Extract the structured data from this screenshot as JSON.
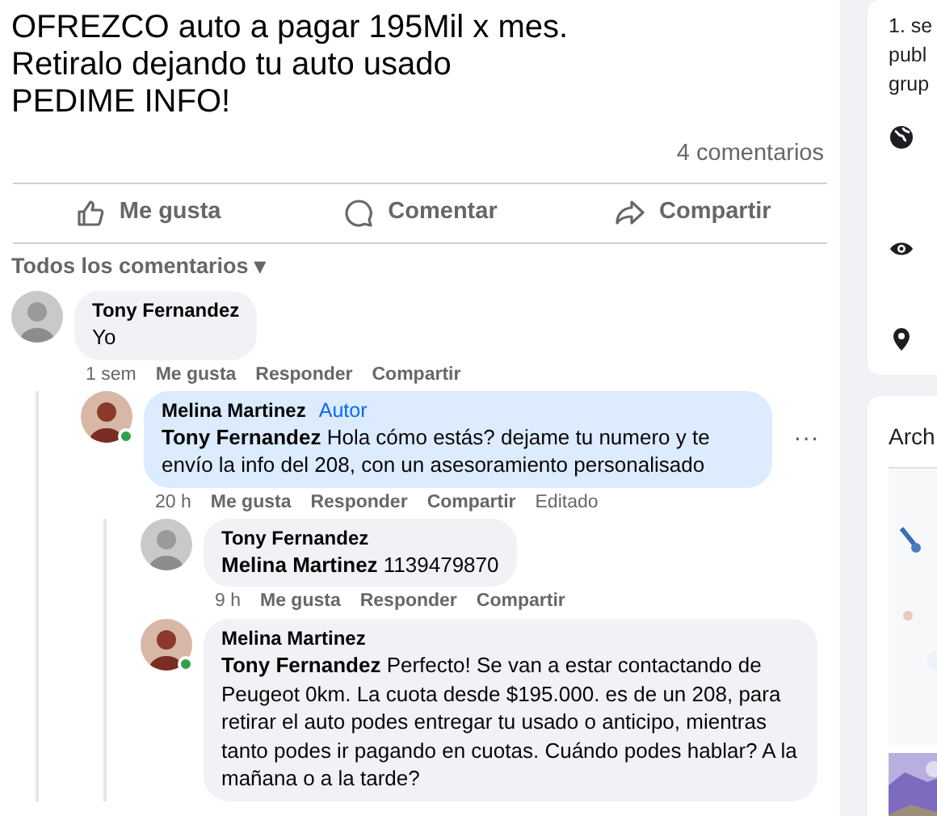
{
  "post": {
    "text_lines": [
      "OFREZCO auto a pagar 195Mil x mes.",
      "Retiralo dejando tu auto usado",
      "PEDIME INFO!"
    ],
    "comment_count": "4 comentarios"
  },
  "actions": [
    {
      "kind": "like",
      "label": "Me gusta"
    },
    {
      "kind": "comment",
      "label": "Comentar"
    },
    {
      "kind": "share",
      "label": "Compartir"
    }
  ],
  "sort": {
    "label": "Todos los comentarios",
    "caret": "▾"
  },
  "comments": [
    {
      "author": "Tony Fernandez",
      "online": false,
      "highlighted": false,
      "text": "Yo",
      "time": "1 sem",
      "actions": [
        "Me gusta",
        "Responder",
        "Compartir"
      ],
      "children": [
        {
          "author": "Melina Martinez",
          "badge": "Autor",
          "online": true,
          "highlighted": true,
          "more_menu": "···",
          "mention": "Tony Fernandez",
          "text": "Hola cómo estás? dejame tu numero y te envío la info del 208, con un asesoramiento personalisado",
          "time": "20 h",
          "actions": [
            "Me gusta",
            "Responder",
            "Compartir"
          ],
          "edited": "Editado",
          "children": [
            {
              "author": "Tony Fernandez",
              "online": false,
              "highlighted": false,
              "mention": "Melina Martinez",
              "text": "1139479870",
              "time": "9 h",
              "actions": [
                "Me gusta",
                "Responder",
                "Compartir"
              ]
            },
            {
              "author": "Melina Martinez",
              "online": true,
              "highlighted": false,
              "mention": "Tony Fernandez",
              "text": "Perfecto! Se van a estar contactando de Peugeot 0km. La cuota desde $195.000. es de un 208, para retirar el auto podes entregar tu usado o anticipo, mientras tanto podes ir pagando en cuotas. Cuándo podes hablar? A la mañana o a la tarde?"
            }
          ]
        }
      ]
    }
  ],
  "sidebar": {
    "about_lines": [
      "1. se",
      "publ",
      "grup"
    ],
    "info_icons": [
      {
        "kind": "globe"
      },
      {
        "kind": "eye"
      },
      {
        "kind": "pin"
      }
    ],
    "media_title": "Arch"
  }
}
